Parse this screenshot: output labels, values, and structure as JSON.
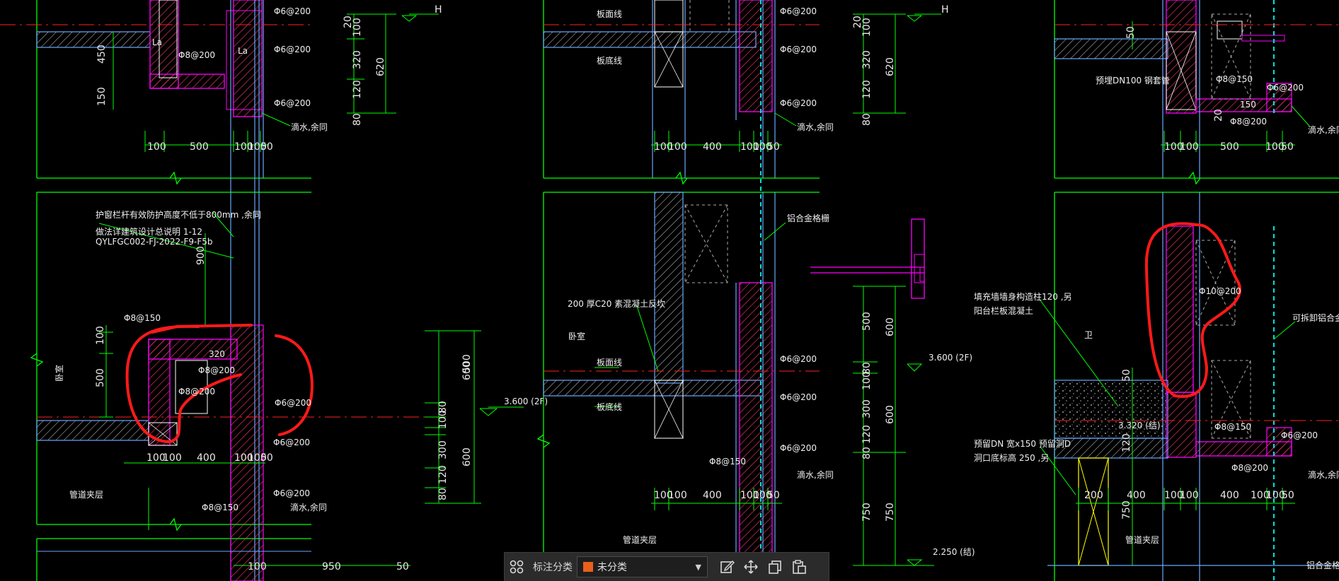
{
  "toolbar": {
    "category_label": "标注分类",
    "category_value": "未分类",
    "category_color": "#e8601c",
    "icons": [
      "grid-icon",
      "edit-icon",
      "move-icon",
      "copy-icon",
      "paste-icon"
    ]
  },
  "drawing": {
    "colors": {
      "background": "#000000",
      "frame": "#00ff00",
      "wall_blue": "#6aa8ff",
      "magenta": "#ff00ff",
      "cyan": "#00e0e0",
      "annotation_red": "#ff1a1a",
      "axis_red": "#ff2020"
    },
    "left_top": {
      "dims_bottom": [
        "100",
        "500",
        "100",
        "100",
        "50"
      ],
      "dims_left": [
        "450",
        "150"
      ],
      "dims_right": [
        "20",
        "100",
        "320",
        "120",
        "80",
        "620"
      ],
      "rebar": [
        "Φ6@200",
        "Φ6@200",
        "Φ6@200",
        "Φ8@200"
      ],
      "note": "滴水,余同",
      "marks": [
        "La",
        "La"
      ]
    },
    "left_mid": {
      "note_line1": "护窗栏杆有效防护高度不低于800mm ,余同",
      "note_line2": "做法详建筑设计总说明 1-12",
      "note_line3": "QYLFGC002-FJ-2022-F9-F5b",
      "dim_900": "900",
      "rebar": [
        "Φ8@150",
        "Φ8@200",
        "Φ8@200",
        "Φ6@200",
        "Φ6@200",
        "Φ6@200",
        "Φ8@150"
      ],
      "dims_left": [
        "100",
        "500"
      ],
      "dims_bottom": [
        "100",
        "100",
        "400",
        "100",
        "100",
        "50"
      ],
      "room1": "卧室",
      "room2": "管道夹层",
      "note": "滴水,余同",
      "bottom_dims": [
        "100",
        "950",
        "50"
      ],
      "mark_320": "320"
    },
    "center_dims": [
      "500",
      "600",
      "80",
      "100",
      "300",
      "600",
      "80",
      "120"
    ],
    "level_a": "3.600 (2F)",
    "middle_top": {
      "labels": [
        "板面线",
        "板底线"
      ],
      "rebar": [
        "Φ6@200",
        "Φ6@200",
        "Φ6@200"
      ],
      "dims_bottom": [
        "100",
        "100",
        "400",
        "100",
        "100",
        "50"
      ],
      "note": "滴水,余同"
    },
    "middle_mid": {
      "note1": "200 厚C20 素混凝土反坎",
      "room": "卧室",
      "labels": [
        "板面线",
        "板底线"
      ],
      "rebar": [
        "Φ6@200",
        "Φ6@200",
        "Φ6@200",
        "Φ8@150"
      ],
      "dims_bottom": [
        "100",
        "100",
        "400",
        "100",
        "100",
        "50"
      ],
      "note": "滴水,余同",
      "railing": "铝合金格栅",
      "room2": "管道夹层"
    },
    "middle_right_dims": [
      "20",
      "100",
      "320",
      "120",
      "80",
      "620",
      "500",
      "600",
      "80",
      "100",
      "300",
      "600",
      "80",
      "120",
      "750",
      "750"
    ],
    "level_b": "3.600 (2F)",
    "level_c": "2.250 (结)",
    "right_top": {
      "dim_150": "150",
      "note": "预埋DN100 钢套管",
      "rebar": [
        "Φ8@150",
        "Φ6@200",
        "Φ8@200"
      ],
      "dims_bottom": [
        "100",
        "100",
        "500",
        "100",
        "50"
      ],
      "dims_left": [
        "20",
        "50"
      ],
      "note2": "滴水,余同"
    },
    "right_mid": {
      "note1": "填充墙墙身构造柱120 ,另",
      "note2": "阳台栏板混凝土",
      "note3": "预留DN 宽x150 预留洞D",
      "note4": "洞口底标高 250 ,另",
      "rebar": [
        "Φ10@200",
        "Φ8@150",
        "Φ6@200",
        "Φ8@200"
      ],
      "railing": "可拆卸铝合金格栅",
      "room": "卫",
      "level": "3.320 (结)",
      "dims_bottom": [
        "200",
        "400",
        "100",
        "100",
        "400",
        "100",
        "100",
        "50"
      ],
      "dims_left": [
        "50",
        "120",
        "750"
      ],
      "note5": "滴水,余同",
      "room2": "管道夹层",
      "railing2": "铝合金格栅"
    },
    "axis_marks": [
      "H",
      "H"
    ]
  }
}
